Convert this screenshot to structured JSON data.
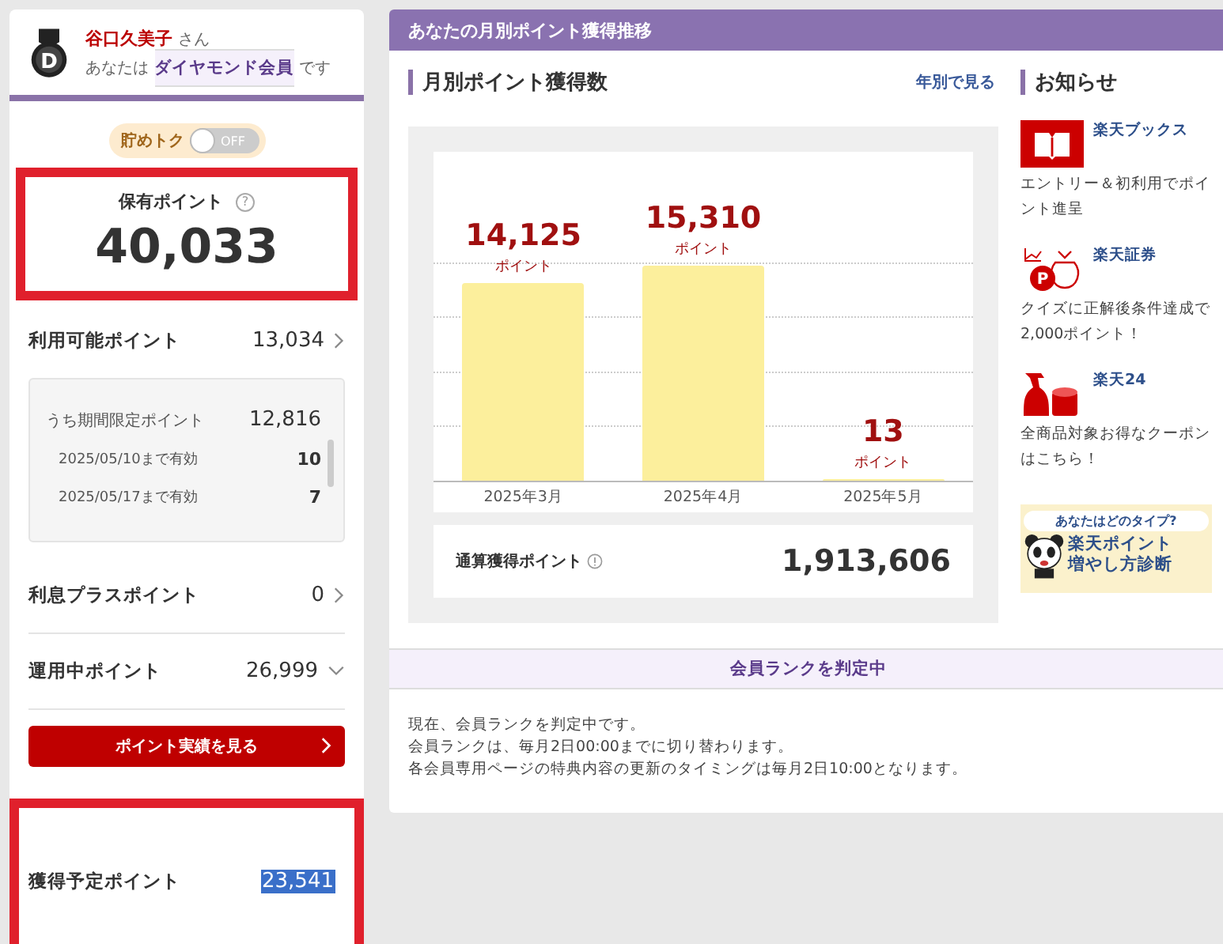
{
  "member": {
    "name": "谷口久美子",
    "honorific": "さん",
    "rank_prefix": "あなたは",
    "rank": "ダイヤモンド会員",
    "rank_suffix": "です",
    "badge_letter": "D"
  },
  "savings_toggle": {
    "label": "貯めトク",
    "state_label": "OFF",
    "on": false
  },
  "held_points": {
    "label": "保有ポイント",
    "help": "?",
    "value": "40,033"
  },
  "available": {
    "label": "利用可能ポイント",
    "value": "13,034",
    "limited": {
      "label": "うち期間限定ポイント",
      "value": "12,816",
      "rows": [
        {
          "label": "2025/05/10まで有効",
          "value": "10"
        },
        {
          "label": "2025/05/17まで有効",
          "value": "7"
        }
      ]
    }
  },
  "point_rows": [
    {
      "label": "利息プラスポイント",
      "value": "0",
      "kind": "link"
    },
    {
      "label": "運用中ポイント",
      "value": "26,999",
      "kind": "expand"
    }
  ],
  "history_button": "ポイント実績を見る",
  "expected": {
    "label": "獲得予定ポイント",
    "value": "23,541",
    "selected": true
  },
  "panel": {
    "title": "あなたの月別ポイント獲得推移",
    "chart_title": "月別ポイント獲得数",
    "yearly_link": "年別で見る",
    "bar_units": [
      "ポイント",
      "ポイント",
      "ポイント"
    ],
    "chart_data": {
      "type": "bar",
      "categories": [
        "2025年3月",
        "2025年4月",
        "2025年5月"
      ],
      "values": [
        14125,
        15310,
        13
      ],
      "value_labels": [
        "14,125",
        "15,310",
        "13"
      ],
      "data_labels": true
    },
    "total": {
      "label": "通算獲得ポイント",
      "value": "1,913,606"
    }
  },
  "news": {
    "title": "お知らせ",
    "items": [
      {
        "kind": "book",
        "title": "楽天ブックス",
        "text": "エントリー＆初利用でポイント進呈"
      },
      {
        "kind": "bag",
        "icon_letter": "P",
        "title": "楽天証券",
        "text": "クイズに正解後条件達成で2,000ポイント！"
      },
      {
        "kind": "bottle",
        "title": "楽天24",
        "text": "全商品対象お得なクーポンはこちら！"
      }
    ],
    "banner": {
      "question": "あなたはどのタイプ?",
      "line1": "楽天ポイント",
      "line2": "増やし方診断"
    }
  },
  "rank_notice": {
    "title": "会員ランクを判定中",
    "lines": [
      "現在、会員ランクを判定中です。",
      "会員ランクは、毎月2日00:00までに切り替わります。",
      "各会員専用ページの特典内容の更新のタイミングは毎月2日10:00となります。"
    ]
  }
}
